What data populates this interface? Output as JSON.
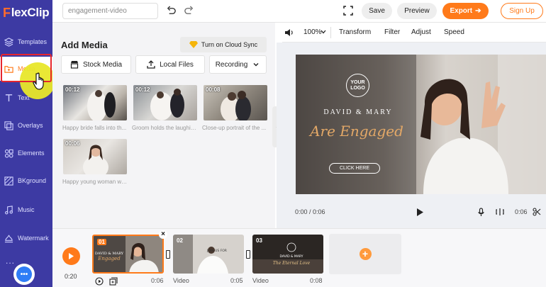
{
  "app": {
    "logo_rest": "lexClip",
    "logo_f": "F"
  },
  "sidebar": {
    "items": [
      {
        "label": "Templates",
        "icon": "layers-icon"
      },
      {
        "label": "Media",
        "icon": "folder-icon"
      },
      {
        "label": "Text",
        "icon": "text-icon"
      },
      {
        "label": "Overlays",
        "icon": "overlays-icon"
      },
      {
        "label": "Elements",
        "icon": "elements-icon"
      },
      {
        "label": "BKground",
        "icon": "background-icon"
      },
      {
        "label": "Music",
        "icon": "music-icon"
      },
      {
        "label": "Watermark",
        "icon": "watermark-icon"
      }
    ],
    "active": "Media",
    "dots": "...",
    "chat_glyph": "•••"
  },
  "topbar": {
    "project_name": "engagement-video",
    "save": "Save",
    "preview": "Preview",
    "export": "Export",
    "export_arrow": "➔",
    "signup": "Sign Up"
  },
  "media_panel": {
    "title": "Add Media",
    "cloud_sync": "Turn on Cloud Sync",
    "stock_media": "Stock Media",
    "local_files": "Local Files",
    "recording": "Recording",
    "thumbnails": [
      {
        "duration": "00:12",
        "caption": "Happy bride falls into th..."
      },
      {
        "duration": "00:12",
        "caption": "Groom holds the laughin..."
      },
      {
        "duration": "00:08",
        "caption": "Close-up portrait of the ..."
      },
      {
        "duration": "00:06",
        "caption": "Happy young woman wit..."
      }
    ],
    "collapse_glyph": "‹"
  },
  "preview": {
    "toolbar": {
      "zoom": "100%",
      "transform": "Transform",
      "filter": "Filter",
      "adjust": "Adjust",
      "speed": "Speed"
    },
    "canvas": {
      "logo_line1": "YOUR",
      "logo_line2": "LOGO",
      "names": "DAVID & MARY",
      "headline": "Are Engaged",
      "cta": "CLICK HERE"
    },
    "time": "0:00 / 0:06",
    "duration_right": "0:06"
  },
  "timeline": {
    "time": "0:20",
    "clips": [
      {
        "num": "01",
        "type": "",
        "duration": "0:06"
      },
      {
        "num": "02",
        "type": "Video",
        "duration": "0:05"
      },
      {
        "num": "03",
        "type": "Video",
        "duration": "0:08"
      }
    ],
    "close": "×",
    "add": "+"
  },
  "colors": {
    "sidebar": "#3d3aa3",
    "accent": "#ff7a1a",
    "highlight": "#e6262e"
  }
}
